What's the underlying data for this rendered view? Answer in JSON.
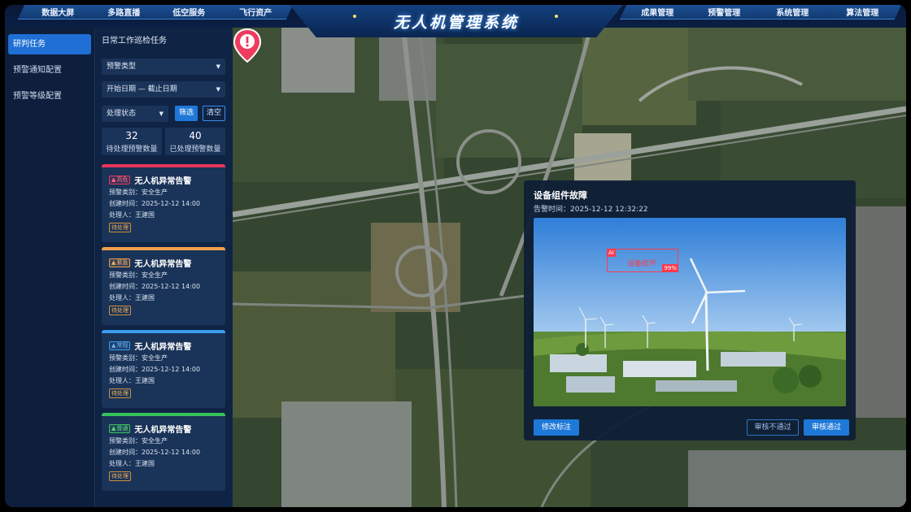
{
  "header": {
    "title": "无人机管理系统",
    "left_tabs": [
      "数据大屏",
      "多路直播",
      "低空服务",
      "飞行资产"
    ],
    "right_tabs": [
      "成果管理",
      "预警管理",
      "系统管理",
      "算法管理"
    ]
  },
  "sidebar": {
    "items": [
      {
        "label": "研判任务",
        "active": true
      },
      {
        "label": "预警通知配置",
        "active": false
      },
      {
        "label": "预警等级配置",
        "active": false
      }
    ]
  },
  "task_panel": {
    "title": "日常工作巡检任务",
    "filters": {
      "alert_type": "预警类型",
      "date_range": "开始日期 — 截止日期",
      "status": "处理状态",
      "filter_button": "筛选",
      "clear_button": "清空"
    },
    "stats": [
      {
        "value": "32",
        "label": "待处理预警数量"
      },
      {
        "value": "40",
        "label": "已处理预警数量"
      }
    ],
    "cards": [
      {
        "level": "高危",
        "color": "#e8365a",
        "title": "无人机异常告警",
        "category": "预警类别：安全生产",
        "created": "创建时间：2025-12-12 14:00",
        "handler": "处理人：王建国",
        "status": "待处理"
      },
      {
        "level": "紧急",
        "color": "#f0a04b",
        "title": "无人机异常告警",
        "category": "预警类别：安全生产",
        "created": "创建时间：2025-12-12 14:00",
        "handler": "处理人：王建国",
        "status": "待处理"
      },
      {
        "level": "常规",
        "color": "#3a9cf0",
        "title": "无人机异常告警",
        "category": "预警类别：安全生产",
        "created": "创建时间：2025-12-12 14:00",
        "handler": "处理人：王建国",
        "status": "待处理"
      },
      {
        "level": "普通",
        "color": "#37c25b",
        "title": "无人机异常告警",
        "category": "预警类别：安全生产",
        "created": "创建时间：2025-12-12 14:00",
        "handler": "处理人：王建国",
        "status": "待处理"
      }
    ]
  },
  "alert_dialog": {
    "title": "设备组件故障",
    "time": "告警时间：2025-12-12 12:32:22",
    "ai_tag": "AI",
    "detection_label": "设备损坏",
    "confidence": "99%",
    "edit_button": "修改标注",
    "reject_button": "审核不通过",
    "approve_button": "审核通过"
  },
  "icons": {
    "map_marker": "alert-pin-icon",
    "caret": "chevron-down-icon",
    "level_tag": "warning-triangle-icon"
  }
}
